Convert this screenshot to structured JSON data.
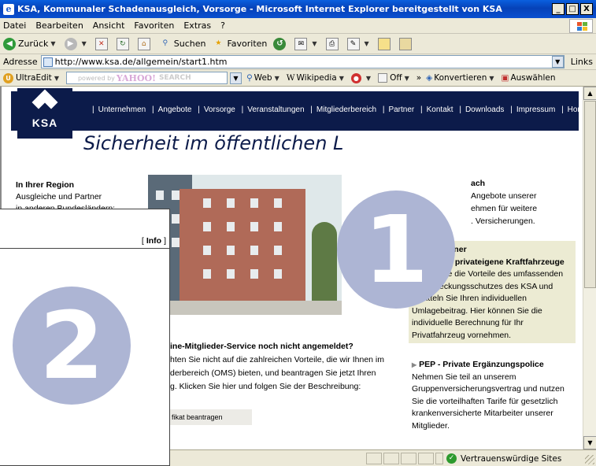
{
  "window": {
    "title": "KSA, Kommunaler Schadenausgleich, Vorsorge - Microsoft Internet Explorer bereitgestellt von KSA",
    "buttons": [
      "_",
      "□",
      "X"
    ]
  },
  "menu": [
    "Datei",
    "Bearbeiten",
    "Ansicht",
    "Favoriten",
    "Extras",
    "?"
  ],
  "toolbar": {
    "back": "Zurück",
    "search": "Suchen",
    "favorites": "Favoriten"
  },
  "address": {
    "label": "Adresse",
    "url": "http://www.ksa.de/allgemein/start1.htm",
    "links": "Links"
  },
  "ultraedit_bar": {
    "ultraedit": "UltraEdit",
    "yahoo_powered": "powered by",
    "yahoo_logo": "YAHOO!",
    "yahoo_search": "SEARCH",
    "web": "Web",
    "wikipedia": "Wikipedia",
    "off": "Off",
    "more": "»",
    "convert": "Konvertieren",
    "select": "Auswählen"
  },
  "site": {
    "logo_text": "KSA",
    "nav": [
      "Unternehmen",
      "Angebote",
      "Vorsorge",
      "Veranstaltungen",
      "Mitgliederbereich",
      "Partner",
      "Kontakt",
      "Downloads",
      "Impressum",
      "Home"
    ],
    "headline": "Sicherheit im öffentlichen L",
    "left": {
      "heading": "In Ihrer Region",
      "line1": "Ausgleiche und Partner",
      "line2": "in anderen Bundesländern:"
    },
    "right_top": {
      "line1": "ach",
      "line2": "Angebote unserer",
      "line3": "ehmen für weitere",
      "line4": ". Versicherungen."
    },
    "tarif": {
      "title": "Tarifrechner",
      "subtitle": "Anerkannt privateigene Kraftfahrzeuge",
      "body": [
        "Nutzen Sie die Vorteile des umfassenden",
        "Kaskodeckungsschutzes des KSA und",
        "ermitteln Sie Ihren individuellen",
        "Umlagebeitrag. Hier können Sie die",
        "individuelle Berechnung für Ihr",
        "Privatfahrzeug vornehmen."
      ]
    },
    "mid": {
      "heading": "ine-Mitglieder-Service noch nicht angemeldet?",
      "line1": "hten Sie nicht auf die zahlreichen Vorteile, die wir Ihnen im",
      "line2": "derbereich (OMS) bieten, und beantragen Sie jetzt Ihren",
      "line3": "g. Klicken Sie hier und folgen Sie der Beschreibung:",
      "button": "fikat beantragen"
    },
    "pep": {
      "title": "PEP - Private Ergänzungspolice",
      "body": [
        "Nehmen Sie teil an unserem",
        "Gruppenversicherungsvertrag und nutzen",
        "Sie die vorteilhaften Tarife für gesetzlich",
        "krankenversicherte Mitarbeiter unserer",
        "Mitglieder."
      ]
    }
  },
  "overlay": {
    "info_open": "[",
    "info_label": "Info",
    "info_close": "]",
    "badge1": "1",
    "badge2": "2"
  },
  "status": {
    "zone": "Vertrauenswürdige Sites"
  }
}
